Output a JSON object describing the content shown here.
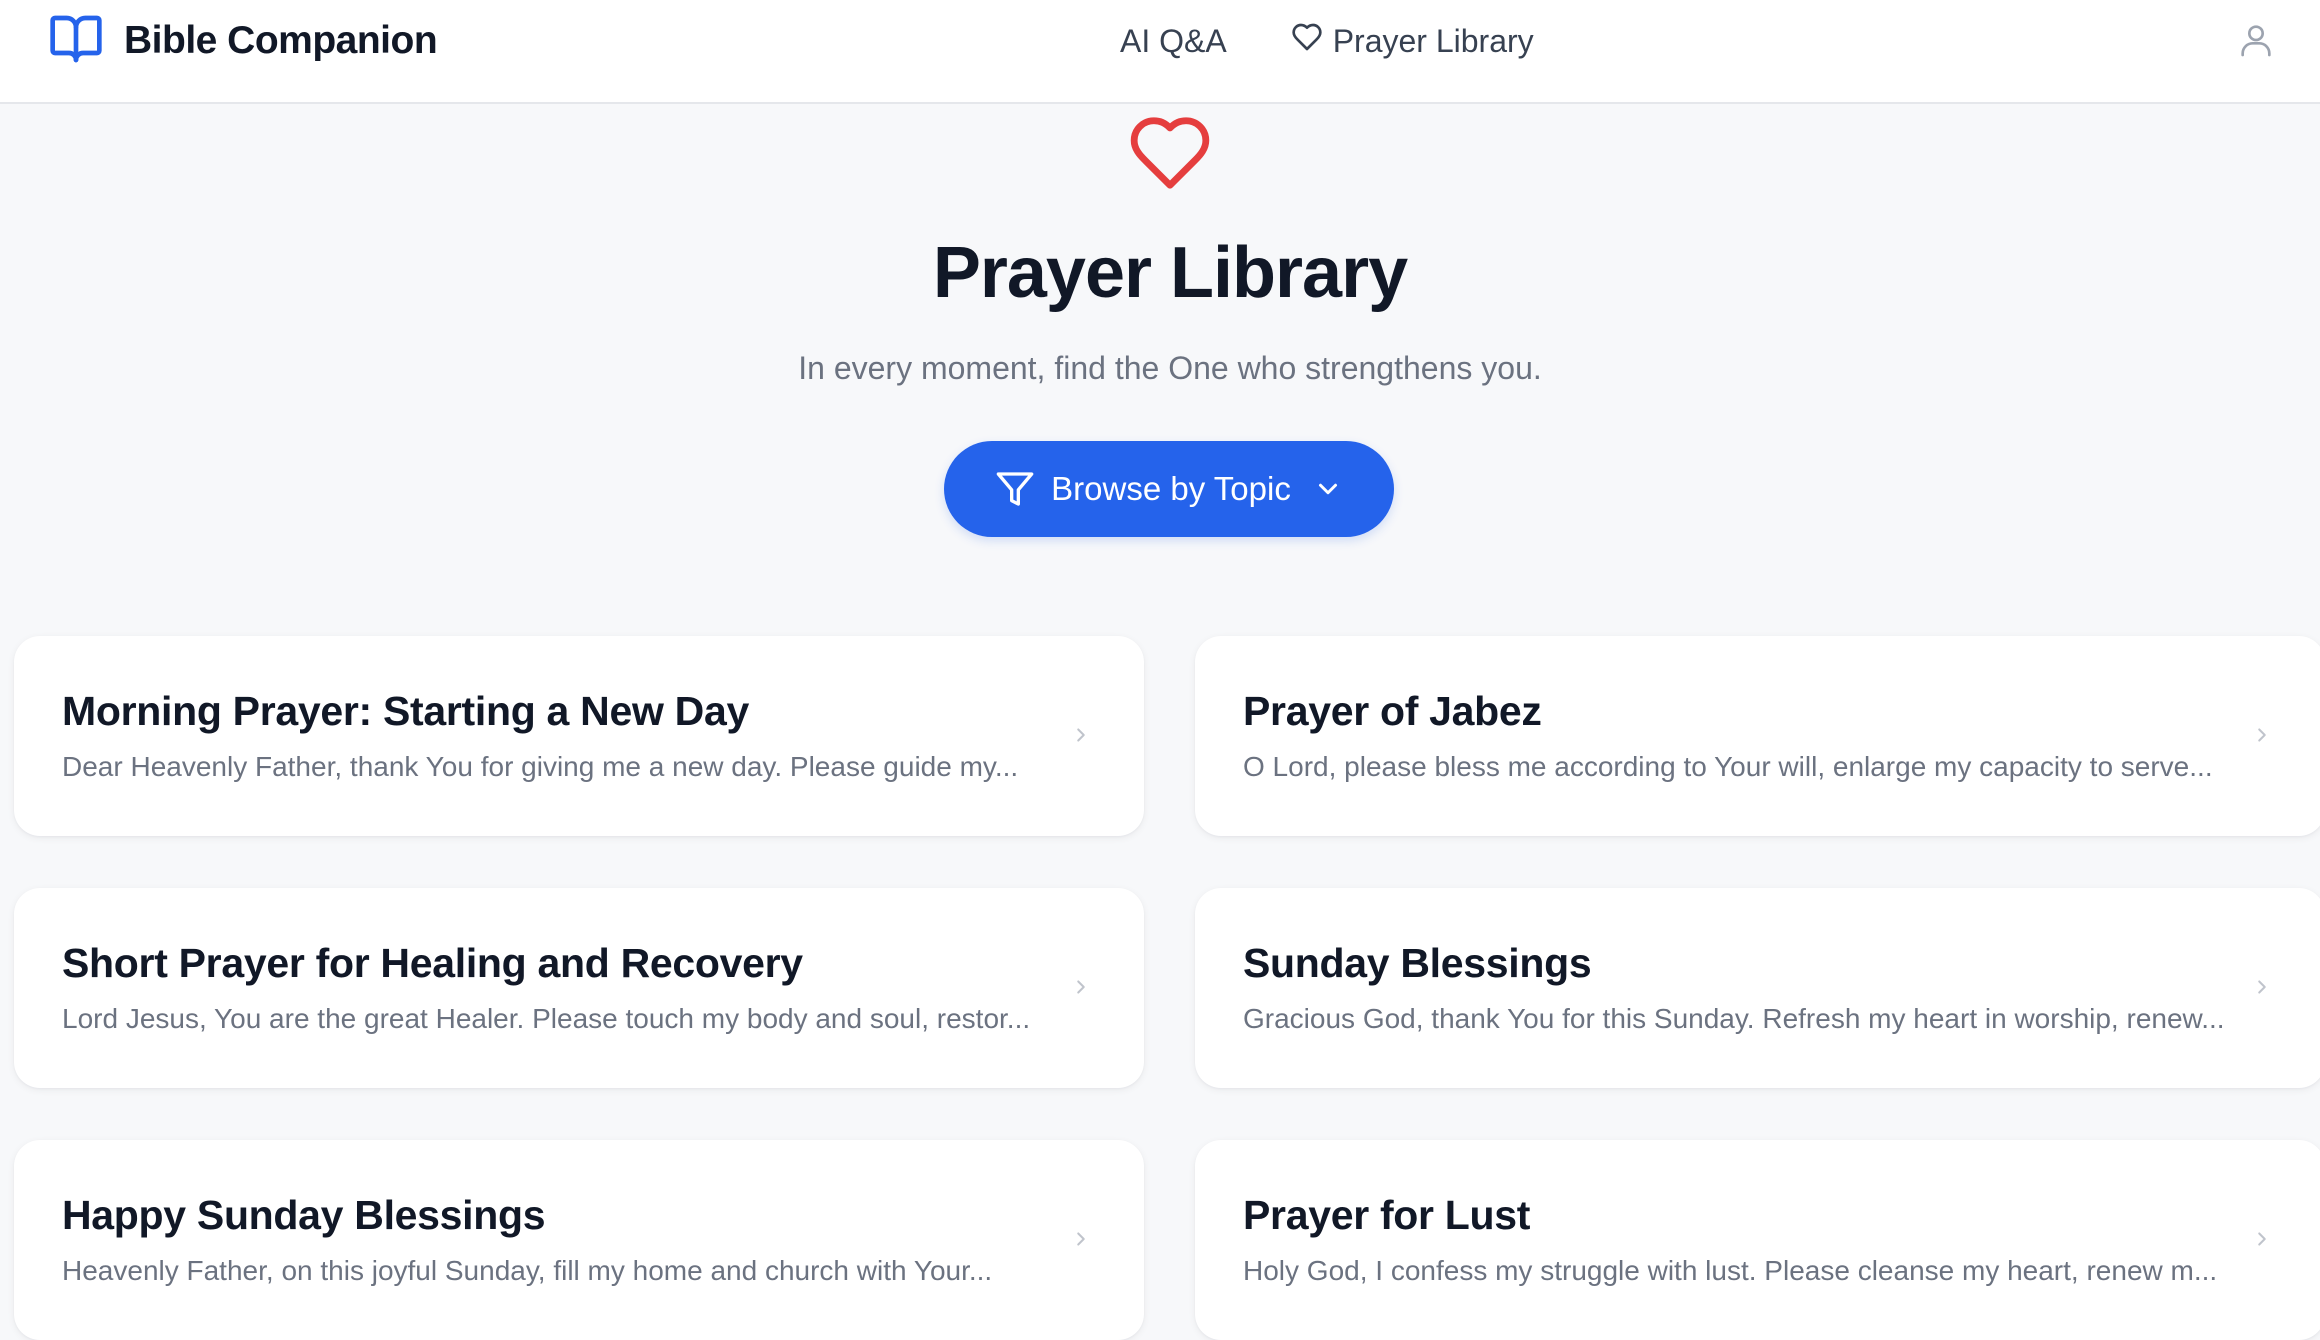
{
  "header": {
    "brand_name": "Bible Companion",
    "brand_icon": "open-book-icon",
    "nav": [
      {
        "label": "AI Q&A"
      },
      {
        "label": "Prayer Library",
        "icon": "heart-outline-icon"
      }
    ],
    "user_icon": "user-icon"
  },
  "hero": {
    "icon": "heart-icon",
    "title": "Prayer Library",
    "subtitle": "In every moment, find the One who strengthens you.",
    "browse_button": {
      "label": "Browse by Topic",
      "icon": "filter-icon",
      "trailing_icon": "chevron-down-icon"
    }
  },
  "prayers": [
    {
      "title": "Morning Prayer: Starting a New Day",
      "excerpt": "Dear Heavenly Father, thank You for giving me a new day. Please guide my..."
    },
    {
      "title": "Prayer of Jabez",
      "excerpt": "O Lord, please bless me according to Your will, enlarge my capacity to serve..."
    },
    {
      "title": "Short Prayer for Healing and Recovery",
      "excerpt": "Lord Jesus, You are the great Healer. Please touch my body and soul, restor..."
    },
    {
      "title": "Sunday Blessings",
      "excerpt": "Gracious God, thank You for this Sunday. Refresh my heart in worship, renew..."
    },
    {
      "title": "Happy Sunday Blessings",
      "excerpt": "Heavenly Father, on this joyful Sunday, fill my home and church with Your..."
    },
    {
      "title": "Prayer for Lust",
      "excerpt": "Holy God, I confess my struggle with lust. Please cleanse my heart, renew m..."
    }
  ],
  "colors": {
    "accent": "#2563eb",
    "heart": "#e53e3e",
    "background": "#f7f8fa",
    "text_primary": "#111827",
    "text_secondary": "#6b7280"
  }
}
